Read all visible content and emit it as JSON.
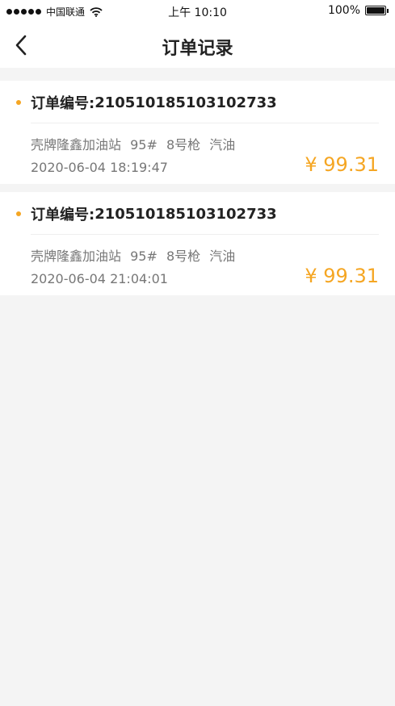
{
  "status_bar": {
    "carrier": "中国联通",
    "time": "上午 10:10",
    "battery": "100%",
    "battery_level": 1.0
  },
  "nav": {
    "title": "订单记录",
    "back_icon": "chevron-left-icon"
  },
  "orders": [
    {
      "number_label": "订单编号:",
      "number": "210510185103102733",
      "station": "壳牌隆鑫加油站",
      "fuel_grade": "95#",
      "nozzle": "8号枪",
      "fuel_type": "汽油",
      "datetime": "2020-06-04 18:19:47",
      "price": "¥ 99.31"
    },
    {
      "number_label": "订单编号:",
      "number": "210510185103102733",
      "station": "壳牌隆鑫加油站",
      "fuel_grade": "95#",
      "nozzle": "8号枪",
      "fuel_type": "汽油",
      "datetime": "2020-06-04 21:04:01",
      "price": "¥ 99.31"
    }
  ],
  "colors": {
    "accent": "#f5a623",
    "background": "#f4f4f4",
    "card": "#ffffff"
  }
}
